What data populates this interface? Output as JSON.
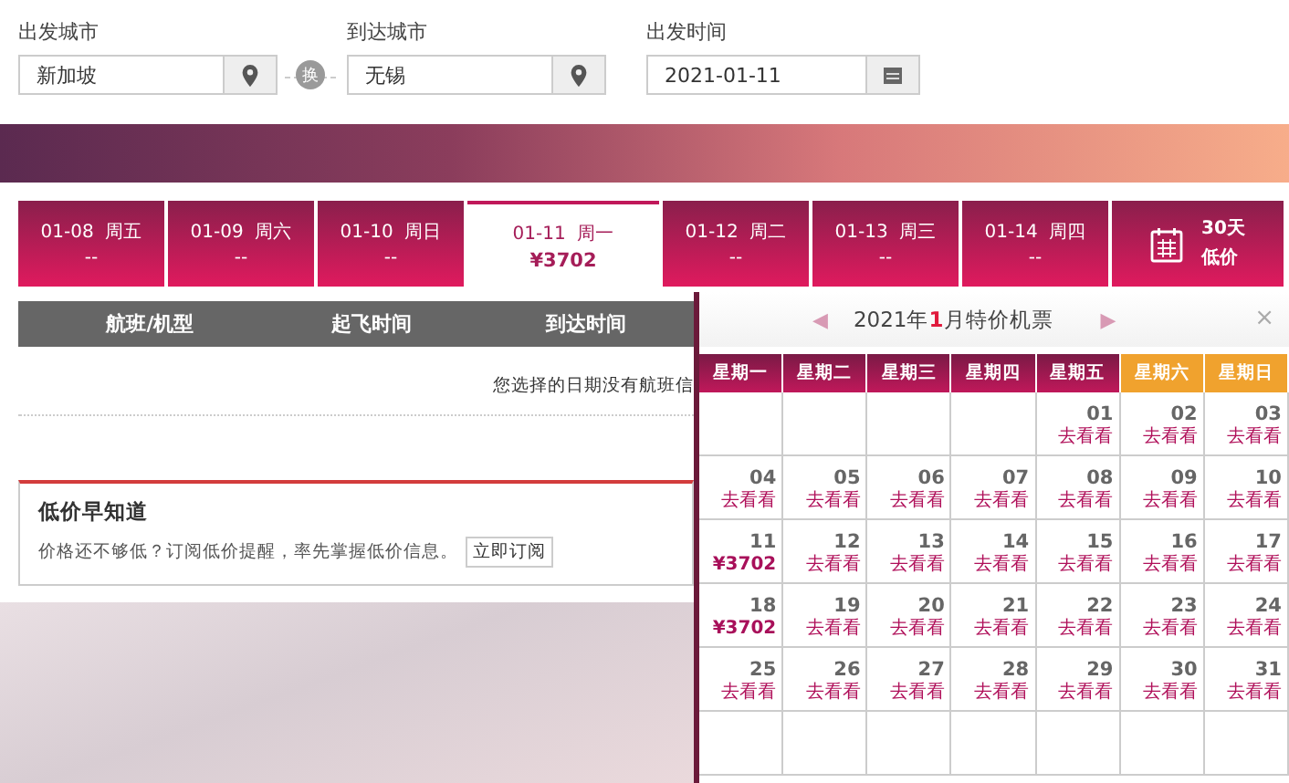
{
  "search_form": {
    "fields": [
      {
        "label": "出发城市",
        "value": "新加坡",
        "kind": "city"
      },
      {
        "label": "到达城市",
        "value": "无锡",
        "kind": "city"
      },
      {
        "label": "出发时间",
        "value": "2021-01-11",
        "kind": "date"
      }
    ],
    "swap_label": "换"
  },
  "date_tabs": [
    {
      "date": "01-08",
      "weekday": "周五",
      "price": "--",
      "selected": false,
      "kind": "day"
    },
    {
      "date": "01-09",
      "weekday": "周六",
      "price": "--",
      "selected": false,
      "kind": "day"
    },
    {
      "date": "01-10",
      "weekday": "周日",
      "price": "--",
      "selected": false,
      "kind": "day"
    },
    {
      "date": "01-11",
      "weekday": "周一",
      "price": "¥3702",
      "selected": true,
      "kind": "day"
    },
    {
      "date": "01-12",
      "weekday": "周二",
      "price": "--",
      "selected": false,
      "kind": "day"
    },
    {
      "date": "01-13",
      "weekday": "周三",
      "price": "--",
      "selected": false,
      "kind": "day"
    },
    {
      "date": "01-14",
      "weekday": "周四",
      "price": "--",
      "selected": false,
      "kind": "day"
    },
    {
      "line1": "30天",
      "line2": "低价",
      "selected": false,
      "kind": "calendar"
    }
  ],
  "flight_table": {
    "columns": [
      "航班/机型",
      "起飞时间",
      "到达时间"
    ],
    "empty_message": "您选择的日期没有航班信"
  },
  "price_alert": {
    "title": "低价早知道",
    "text": "价格还不够低？订阅低价提醒，率先掌握低价信息。",
    "button": "立即订阅"
  },
  "calendar": {
    "title": "2021年**1**月特价机票",
    "prev": "◀",
    "next": "▶",
    "close": "×",
    "weekdays": [
      {
        "label": "星期一",
        "weekend": false
      },
      {
        "label": "星期二",
        "weekend": false
      },
      {
        "label": "星期三",
        "weekend": false
      },
      {
        "label": "星期四",
        "weekend": false
      },
      {
        "label": "星期五",
        "weekend": false
      },
      {
        "label": "星期六",
        "weekend": true
      },
      {
        "label": "星期日",
        "weekend": true
      }
    ],
    "weeks": [
      [
        {
          "kind": "blank"
        },
        {
          "kind": "blank"
        },
        {
          "kind": "blank"
        },
        {
          "kind": "blank"
        },
        {
          "kind": "day",
          "day": "01",
          "note": "去看看"
        },
        {
          "kind": "day",
          "day": "02",
          "note": "去看看"
        },
        {
          "kind": "day",
          "day": "03",
          "note": "去看看"
        }
      ],
      [
        {
          "kind": "day",
          "day": "04",
          "note": "去看看"
        },
        {
          "kind": "day",
          "day": "05",
          "note": "去看看"
        },
        {
          "kind": "day",
          "day": "06",
          "note": "去看看"
        },
        {
          "kind": "day",
          "day": "07",
          "note": "去看看"
        },
        {
          "kind": "day",
          "day": "08",
          "note": "去看看"
        },
        {
          "kind": "day",
          "day": "09",
          "note": "去看看"
        },
        {
          "kind": "day",
          "day": "10",
          "note": "去看看"
        }
      ],
      [
        {
          "kind": "price",
          "day": "11",
          "note": "¥3702"
        },
        {
          "kind": "day",
          "day": "12",
          "note": "去看看"
        },
        {
          "kind": "day",
          "day": "13",
          "note": "去看看"
        },
        {
          "kind": "day",
          "day": "14",
          "note": "去看看"
        },
        {
          "kind": "day",
          "day": "15",
          "note": "去看看"
        },
        {
          "kind": "day",
          "day": "16",
          "note": "去看看"
        },
        {
          "kind": "day",
          "day": "17",
          "note": "去看看"
        }
      ],
      [
        {
          "kind": "price",
          "day": "18",
          "note": "¥3702"
        },
        {
          "kind": "day",
          "day": "19",
          "note": "去看看"
        },
        {
          "kind": "day",
          "day": "20",
          "note": "去看看"
        },
        {
          "kind": "day",
          "day": "21",
          "note": "去看看"
        },
        {
          "kind": "day",
          "day": "22",
          "note": "去看看"
        },
        {
          "kind": "day",
          "day": "23",
          "note": "去看看"
        },
        {
          "kind": "day",
          "day": "24",
          "note": "去看看"
        }
      ],
      [
        {
          "kind": "day",
          "day": "25",
          "note": "去看看"
        },
        {
          "kind": "day",
          "day": "26",
          "note": "去看看"
        },
        {
          "kind": "day",
          "day": "27",
          "note": "去看看"
        },
        {
          "kind": "day",
          "day": "28",
          "note": "去看看"
        },
        {
          "kind": "day",
          "day": "29",
          "note": "去看看"
        },
        {
          "kind": "day",
          "day": "30",
          "note": "去看看"
        },
        {
          "kind": "day",
          "day": "31",
          "note": "去看看"
        }
      ],
      [
        {
          "kind": "blank"
        },
        {
          "kind": "blank"
        },
        {
          "kind": "blank"
        },
        {
          "kind": "blank"
        },
        {
          "kind": "blank"
        },
        {
          "kind": "blank"
        },
        {
          "kind": "blank"
        }
      ]
    ]
  }
}
